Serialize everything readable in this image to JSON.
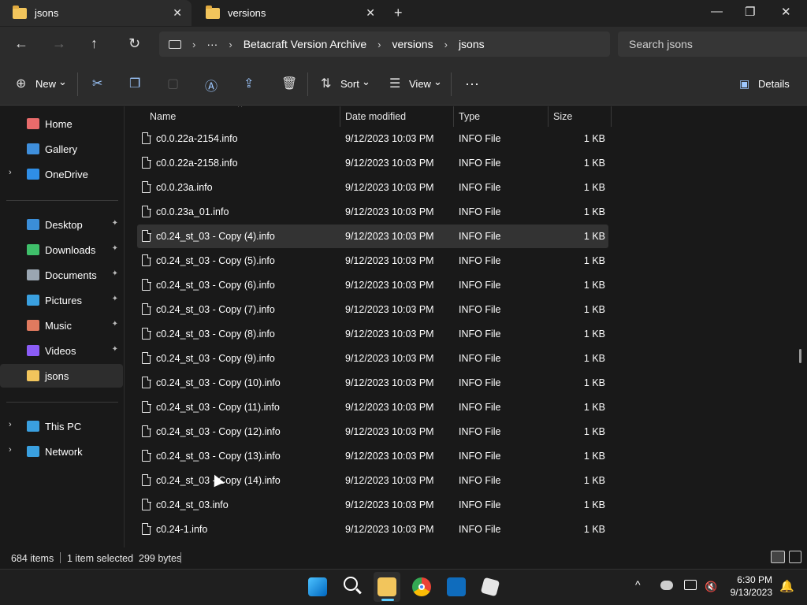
{
  "tabs": [
    {
      "label": "jsons",
      "close": "✕"
    },
    {
      "label": "versions",
      "close": "✕"
    }
  ],
  "newtab": "+",
  "window": {
    "minimize": "—",
    "maximize": "❐",
    "close": "✕"
  },
  "nav": {
    "back": "←",
    "forward": "→",
    "up": "↑",
    "refresh": "↻"
  },
  "address": {
    "more": "···",
    "crumbs": [
      "Betacraft Version Archive",
      "versions",
      "jsons"
    ],
    "sep": "›"
  },
  "search": {
    "placeholder": "Search jsons"
  },
  "toolbar": {
    "new": "New",
    "sort": "Sort",
    "view": "View",
    "more": "···",
    "details": "Details",
    "caret": "⌄"
  },
  "sidebar": {
    "top": [
      {
        "label": "Home",
        "color": "#e86b6b"
      },
      {
        "label": "Gallery",
        "color": "#3f8fdc"
      },
      {
        "label": "OneDrive",
        "color": "#2f8ee6",
        "expand": "›"
      }
    ],
    "quick": [
      {
        "label": "Desktop",
        "color": "#3b8ed8",
        "pin": "📌"
      },
      {
        "label": "Downloads",
        "color": "#3fbf6a",
        "pin": "📌"
      },
      {
        "label": "Documents",
        "color": "#9aa6b2",
        "pin": "📌"
      },
      {
        "label": "Pictures",
        "color": "#3aa0e0",
        "pin": "📌"
      },
      {
        "label": "Music",
        "color": "#e07a5f",
        "pin": "📌"
      },
      {
        "label": "Videos",
        "color": "#8b5cf6",
        "pin": "📌"
      },
      {
        "label": "jsons",
        "color": "#f2c55c"
      }
    ],
    "bottom": [
      {
        "label": "This PC",
        "color": "#3aa0e0",
        "expand": "›"
      },
      {
        "label": "Network",
        "color": "#3aa0e0",
        "expand": "›"
      }
    ]
  },
  "columns": {
    "name": "Name",
    "date": "Date modified",
    "type": "Type",
    "size": "Size",
    "sort_caret": "^"
  },
  "files": [
    {
      "name": "c0.0.22a-2154.info",
      "date": "9/12/2023 10:03 PM",
      "type": "INFO File",
      "size": "1 KB"
    },
    {
      "name": "c0.0.22a-2158.info",
      "date": "9/12/2023 10:03 PM",
      "type": "INFO File",
      "size": "1 KB"
    },
    {
      "name": "c0.0.23a.info",
      "date": "9/12/2023 10:03 PM",
      "type": "INFO File",
      "size": "1 KB"
    },
    {
      "name": "c0.0.23a_01.info",
      "date": "9/12/2023 10:03 PM",
      "type": "INFO File",
      "size": "1 KB"
    },
    {
      "name": "c0.24_st_03 - Copy (4).info",
      "date": "9/12/2023 10:03 PM",
      "type": "INFO File",
      "size": "1 KB",
      "selected": true
    },
    {
      "name": "c0.24_st_03 - Copy (5).info",
      "date": "9/12/2023 10:03 PM",
      "type": "INFO File",
      "size": "1 KB"
    },
    {
      "name": "c0.24_st_03 - Copy (6).info",
      "date": "9/12/2023 10:03 PM",
      "type": "INFO File",
      "size": "1 KB"
    },
    {
      "name": "c0.24_st_03 - Copy (7).info",
      "date": "9/12/2023 10:03 PM",
      "type": "INFO File",
      "size": "1 KB"
    },
    {
      "name": "c0.24_st_03 - Copy (8).info",
      "date": "9/12/2023 10:03 PM",
      "type": "INFO File",
      "size": "1 KB"
    },
    {
      "name": "c0.24_st_03 - Copy (9).info",
      "date": "9/12/2023 10:03 PM",
      "type": "INFO File",
      "size": "1 KB"
    },
    {
      "name": "c0.24_st_03 - Copy (10).info",
      "date": "9/12/2023 10:03 PM",
      "type": "INFO File",
      "size": "1 KB"
    },
    {
      "name": "c0.24_st_03 - Copy (11).info",
      "date": "9/12/2023 10:03 PM",
      "type": "INFO File",
      "size": "1 KB"
    },
    {
      "name": "c0.24_st_03 - Copy (12).info",
      "date": "9/12/2023 10:03 PM",
      "type": "INFO File",
      "size": "1 KB"
    },
    {
      "name": "c0.24_st_03 - Copy (13).info",
      "date": "9/12/2023 10:03 PM",
      "type": "INFO File",
      "size": "1 KB"
    },
    {
      "name": "c0.24_st_03 - Copy (14).info",
      "date": "9/12/2023 10:03 PM",
      "type": "INFO File",
      "size": "1 KB"
    },
    {
      "name": "c0.24_st_03.info",
      "date": "9/12/2023 10:03 PM",
      "type": "INFO File",
      "size": "1 KB"
    },
    {
      "name": "c0.24-1.info",
      "date": "9/12/2023 10:03 PM",
      "type": "INFO File",
      "size": "1 KB"
    }
  ],
  "status": {
    "count": "684 items",
    "selection": "1 item selected  299 bytes"
  },
  "clock": {
    "time": "6:30 PM",
    "date": "9/13/2023"
  },
  "taskbar": {
    "overflow": "^"
  }
}
